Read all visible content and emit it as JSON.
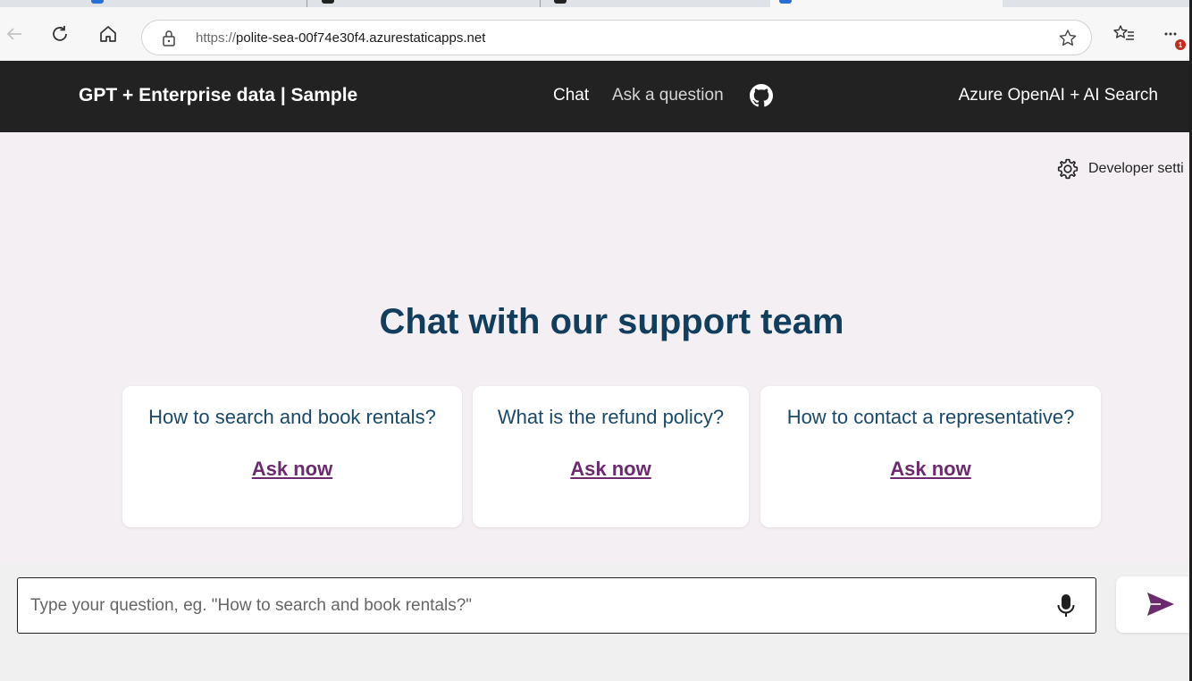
{
  "browser": {
    "url_scheme": "https://",
    "url_host": "polite-sea-00f74e30f4.azurestaticapps.net",
    "notification_count": "1"
  },
  "header": {
    "title": "GPT + Enterprise data | Sample",
    "nav": {
      "chat": "Chat",
      "ask": "Ask a question"
    },
    "right_text": "Azure OpenAI + AI Search"
  },
  "developer_settings_label": "Developer setti",
  "heading": "Chat with our support team",
  "examples": [
    {
      "question": "How to search and book rentals?",
      "link": "Ask now"
    },
    {
      "question": "What is the refund policy?",
      "link": "Ask now"
    },
    {
      "question": "How to contact a representative?",
      "link": "Ask now"
    }
  ],
  "question_input": {
    "placeholder": "Type your question, eg. \"How to search and book rentals?\"",
    "value": ""
  },
  "colors": {
    "header_bg": "#222222",
    "page_bg": "#f3eff2",
    "heading": "#123e5e",
    "link": "#6b2b6e",
    "send_icon": "#6b2b6e"
  },
  "icons": {
    "back": "back-arrow-icon",
    "refresh": "refresh-icon",
    "home": "home-icon",
    "site_info": "lock-icon",
    "favorite": "star-icon",
    "favorites_list": "favorites-icon",
    "more": "more-icon",
    "github": "github-icon",
    "settings": "gear-icon",
    "mic": "microphone-icon",
    "send": "send-icon"
  }
}
